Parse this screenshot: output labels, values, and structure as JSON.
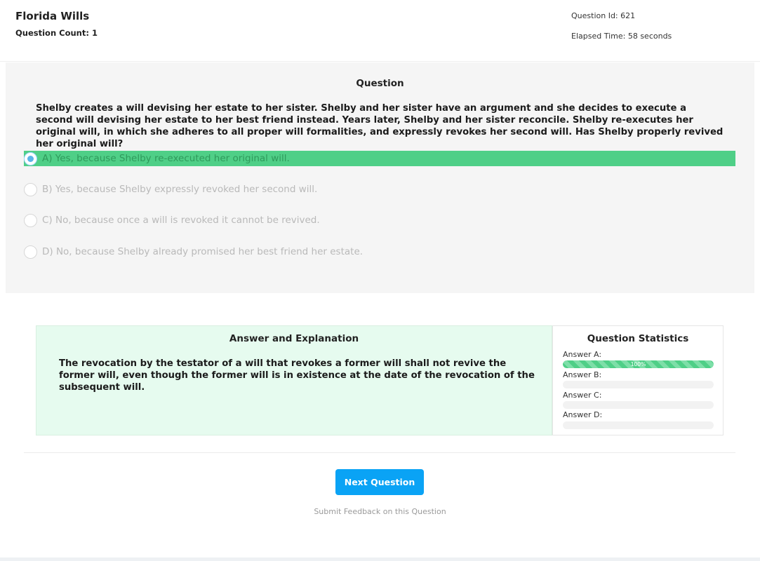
{
  "header": {
    "subject": "Florida Wills",
    "question_count": "Question Count: 1",
    "question_id": "Question Id: 621",
    "elapsed_time": "Elapsed Time: 58 seconds"
  },
  "question": {
    "heading": "Question",
    "text": "Shelby creates a will devising her estate to her sister. Shelby and her sister have an argument and she decides to execute a second will devising her estate to her best friend instead. Years later, Shelby and her sister reconcile. Shelby re-executes her original will, in which she adheres to all proper will formalities, and expressly revokes her second will. Has Shelby properly revived her original will?",
    "choices": [
      {
        "label": "A) Yes, because Shelby re-executed her original will.",
        "selected": true
      },
      {
        "label": "B) Yes, because Shelby expressly revoked her second will.",
        "selected": false
      },
      {
        "label": "C) No, because once a will is revoked it cannot be revived.",
        "selected": false
      },
      {
        "label": "D) No, because Shelby already promised her best friend her estate.",
        "selected": false
      }
    ]
  },
  "explanation": {
    "heading": "Answer and Explanation",
    "text": "The revocation by the testator of a will that revokes a former will shall not revive the former will, even though the former will is in existence at the date of the revocation of the subsequent will."
  },
  "statistics": {
    "heading": "Question Statistics",
    "answers": [
      {
        "label": "Answer A:",
        "percent": 100,
        "percent_label": "100%"
      },
      {
        "label": "Answer B:",
        "percent": 0,
        "percent_label": ""
      },
      {
        "label": "Answer C:",
        "percent": 0,
        "percent_label": ""
      },
      {
        "label": "Answer D:",
        "percent": 0,
        "percent_label": ""
      }
    ]
  },
  "actions": {
    "next_label": "Next Question",
    "feedback_label": "Submit Feedback on this Question"
  },
  "colors": {
    "selected_green": "#4fcf87",
    "button_blue": "#0aa3f5",
    "explanation_bg": "#e6fbef"
  }
}
